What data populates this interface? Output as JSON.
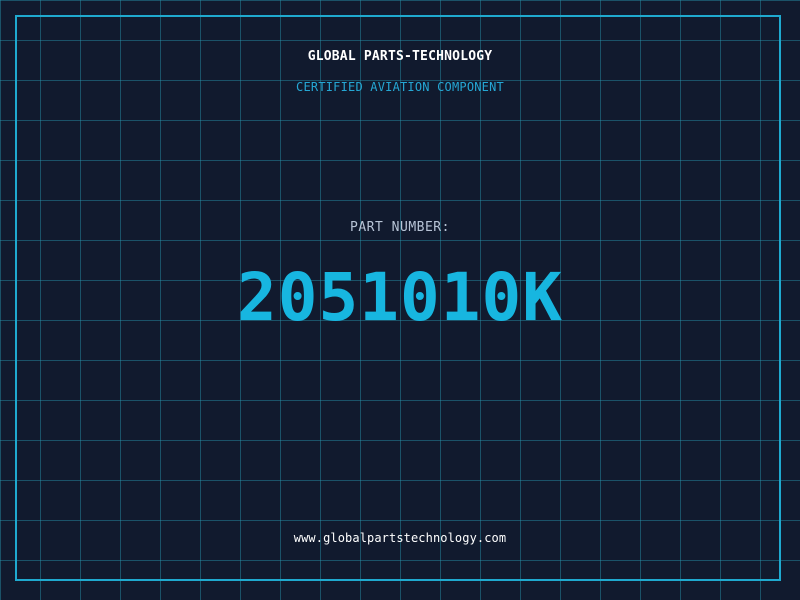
{
  "header": {
    "company_name": "GLOBAL PARTS-TECHNOLOGY",
    "certification": "CERTIFIED AVIATION COMPONENT"
  },
  "part": {
    "label": "PART NUMBER:",
    "number": "2051010K"
  },
  "footer": {
    "website": "www.globalpartstechnology.com"
  },
  "colors": {
    "background": "#111a2e",
    "grid": "#2896af",
    "frame": "#1fa9cf",
    "accent": "#17b6e0",
    "certification_text": "#25a7d4",
    "label_text": "#b8c4d6",
    "primary_text": "#ffffff"
  }
}
